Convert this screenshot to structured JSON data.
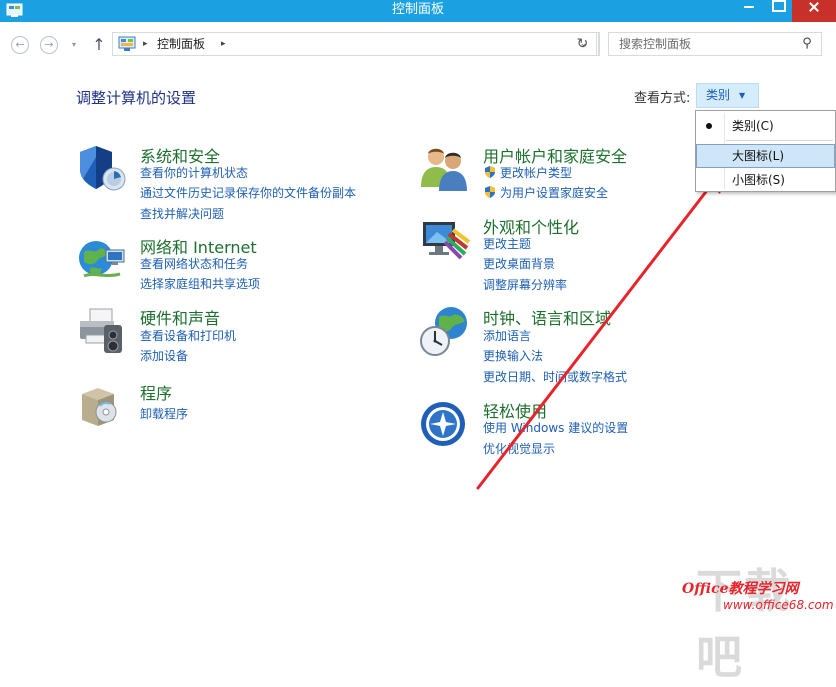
{
  "window": {
    "title": "控制面板"
  },
  "nav": {
    "back_symbol": "←",
    "forward_symbol": "→",
    "recent_symbol": "▾",
    "up_symbol": "↑",
    "breadcrumb_sep": "▸",
    "breadcrumb": "控制面板",
    "dropdown_symbol": "⌄",
    "refresh_symbol": "↻",
    "search_placeholder": "搜索控制面板",
    "search_symbol": "⚲"
  },
  "heading": "调整计算机的设置",
  "view_by": {
    "label": "查看方式:",
    "value": "类别",
    "caret": "▼",
    "options": [
      "类别(C)",
      "大图标(L)",
      "小图标(S)"
    ]
  },
  "categories_left": [
    {
      "title": "系统和安全",
      "links": [
        "查看你的计算机状态",
        "通过文件历史记录保存你的文件备份副本",
        "查找并解决问题"
      ]
    },
    {
      "title": "网络和 Internet",
      "links": [
        "查看网络状态和任务",
        "选择家庭组和共享选项"
      ]
    },
    {
      "title": "硬件和声音",
      "links": [
        "查看设备和打印机",
        "添加设备"
      ]
    },
    {
      "title": "程序",
      "links": [
        "卸载程序"
      ]
    }
  ],
  "categories_right": [
    {
      "title": "用户帐户和家庭安全",
      "links": [
        "更改帐户类型",
        "为用户设置家庭安全"
      ]
    },
    {
      "title": "外观和个性化",
      "links": [
        "更改主题",
        "更改桌面背景",
        "调整屏幕分辨率"
      ]
    },
    {
      "title": "时钟、语言和区域",
      "links": [
        "添加语言",
        "更换输入法",
        "更改日期、时间或数字格式"
      ]
    },
    {
      "title": "轻松使用",
      "links": [
        "使用 Windows 建议的设置",
        "优化视觉显示"
      ]
    }
  ],
  "watermark": {
    "large": "下载吧",
    "brand": "Office教程学习网",
    "url": "www.office68.com"
  },
  "colors": {
    "titlebar": "#1ba1e2",
    "category_title": "#1d6f2e",
    "link": "#1e5fb4",
    "arrow": "#e8232a"
  }
}
